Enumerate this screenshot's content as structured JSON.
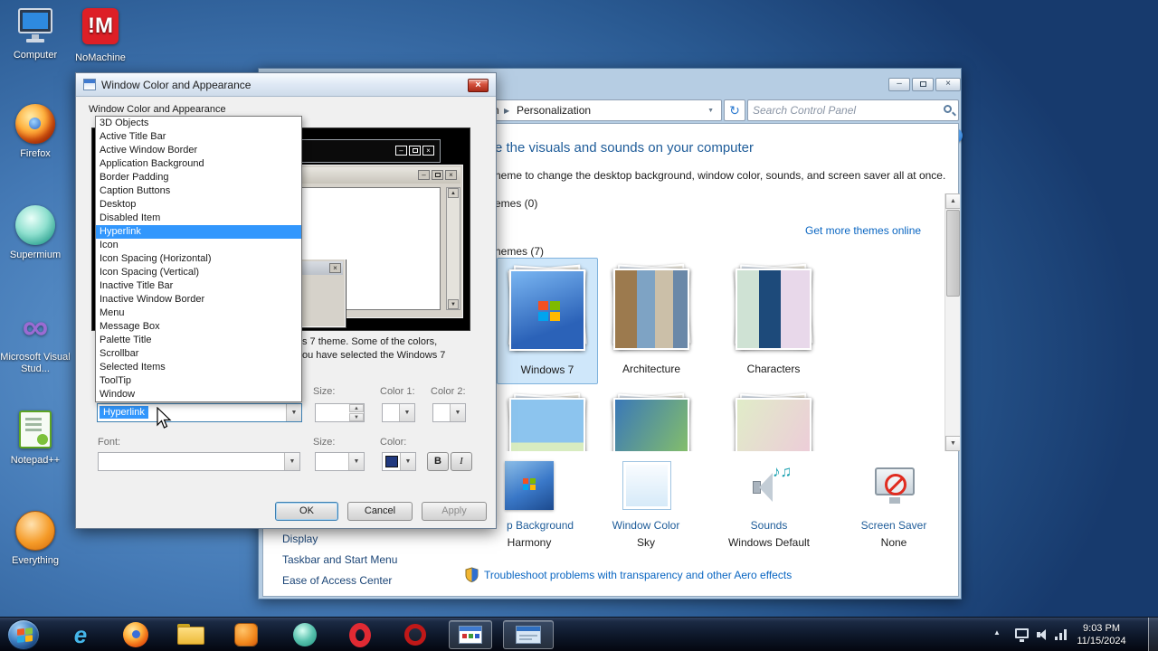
{
  "desktop": {
    "icons": [
      {
        "label": "Computer"
      },
      {
        "label": "NoMachine"
      },
      {
        "label": "Firefox"
      },
      {
        "label": "Supermium"
      },
      {
        "label": "Microsoft Visual Stud..."
      },
      {
        "label": "Notepad++"
      },
      {
        "label": "Everything"
      }
    ]
  },
  "dialog": {
    "title": "Window Color and Appearance",
    "tab_label": "Window Color and Appearance",
    "items_open_list": [
      "3D Objects",
      "Active Title Bar",
      "Active Window Border",
      "Application Background",
      "Border Padding",
      "Caption Buttons",
      "Desktop",
      "Disabled Item",
      "Hyperlink",
      "Icon",
      "Icon Spacing (Horizontal)",
      "Icon Spacing (Vertical)",
      "Inactive Title Bar",
      "Inactive Window Border",
      "Menu",
      "Message Box",
      "Palette Title",
      "Scrollbar",
      "Selected Items",
      "ToolTip",
      "Window"
    ],
    "selected_item": "Hyperlink",
    "item_value": "Hyperlink",
    "labels": {
      "size": "Size:",
      "color1": "Color 1:",
      "color2": "Color 2:",
      "font": "Font:",
      "font_size": "Size:",
      "font_color": "Color:"
    },
    "note_line1": "s 7 theme.  Some of the colors,",
    "note_line2": "ou have selected the Windows 7",
    "buttons": {
      "ok": "OK",
      "cancel": "Cancel",
      "apply": "Apply",
      "bold": "B",
      "italic": "I"
    }
  },
  "personalization": {
    "breadcrumb_fragment": "n",
    "breadcrumb_item": "Personalization",
    "search_placeholder": "Search Control Panel",
    "heading_fragment": "e the visuals and sounds on your computer",
    "subheading_fragment": "heme to change the desktop background, window color, sounds, and screen saver all at once.",
    "my_themes_fragment": "emes (0)",
    "aero_themes_fragment": "hemes (7)",
    "get_more_themes_link": "Get more themes online",
    "theme_names": [
      "Windows 7",
      "Architecture",
      "Characters"
    ],
    "items": [
      {
        "title": "p Background",
        "value": "Harmony"
      },
      {
        "title": "Window Color",
        "value": "Sky"
      },
      {
        "title": "Sounds",
        "value": "Windows Default"
      },
      {
        "title": "Screen Saver",
        "value": "None"
      }
    ],
    "troubleshoot_link": "Troubleshoot problems with transparency and other Aero effects",
    "sidebar_links": [
      "Display",
      "Taskbar and Start Menu",
      "Ease of Access Center"
    ]
  },
  "taskbar": {
    "time": "9:03 PM",
    "date": "11/15/2024"
  },
  "glyphs": {
    "close": "×",
    "minimize": "–",
    "dropdown_arrow": "▼",
    "spinner_up": "▲",
    "spinner_down": "▼",
    "breadcrumb_arrow": "▶",
    "refresh": "↻",
    "help": "?",
    "scroll_up": "▲",
    "scroll_down": "▼",
    "tray_chevron": "▲",
    "music_notes": "♪♫",
    "nomachine_logo": "!M",
    "ie_logo": "e",
    "vs_logo": "∞"
  }
}
